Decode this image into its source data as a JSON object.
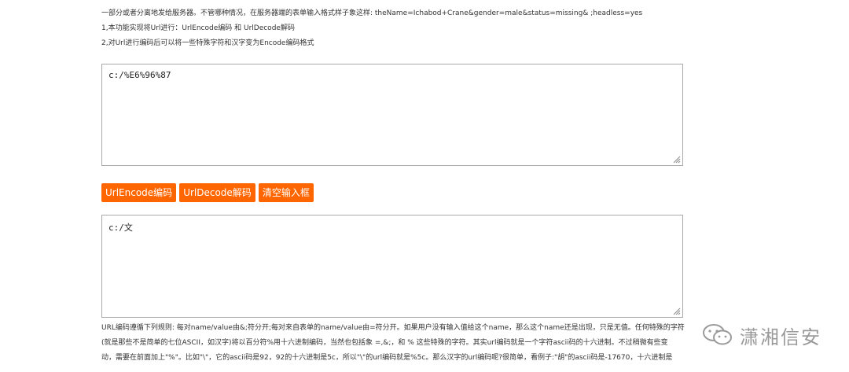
{
  "intro": {
    "line1": "一部分或者分离地发给服务器。不管哪种情况，在服务器端的表单输入格式样子象这样: theName=Ichabod+Crane&gender=male&status=missing& ;headless=yes",
    "line2": "1,本功能实现将Url进行：UrlEncode编码 和 UrlDecode解码",
    "line3": "2,对Url进行编码后可以将一些特殊字符和汉字变为Encode编码格式"
  },
  "input_box": {
    "value": "c:/%E6%96%87"
  },
  "buttons": {
    "encode": "UrlEncode编码",
    "decode": "UrlDecode解码",
    "clear": "清空输入框"
  },
  "output_box": {
    "value": "c:/文"
  },
  "explain": {
    "line1": "URL编码遵循下列规则: 每对name/value由&;符分开;每对来自表单的name/value由=符分开。如果用户没有输入值给这个name，那么这个name还是出现，只是无值。任何特殊的字符",
    "line2": "(就是那些不是简单的七位ASCII，如汉字)将以百分符%用十六进制编码，当然也包括象 =,&;，和 % 这些特殊的字符。其实url编码就是一个字符ascii码的十六进制。不过稍微有些变",
    "line3": "动，需要在前面加上\"%\"。比如\"\\\"，它的ascii码是92，92的十六进制是5c，所以\"\\\"的url编码就是%5c。那么汉字的url编码呢?很简单，看例子:\"胡\"的ascii码是-17670，十六进制是"
  },
  "watermark": {
    "text": "潇湘信安",
    "icon": "wechat-icon"
  }
}
